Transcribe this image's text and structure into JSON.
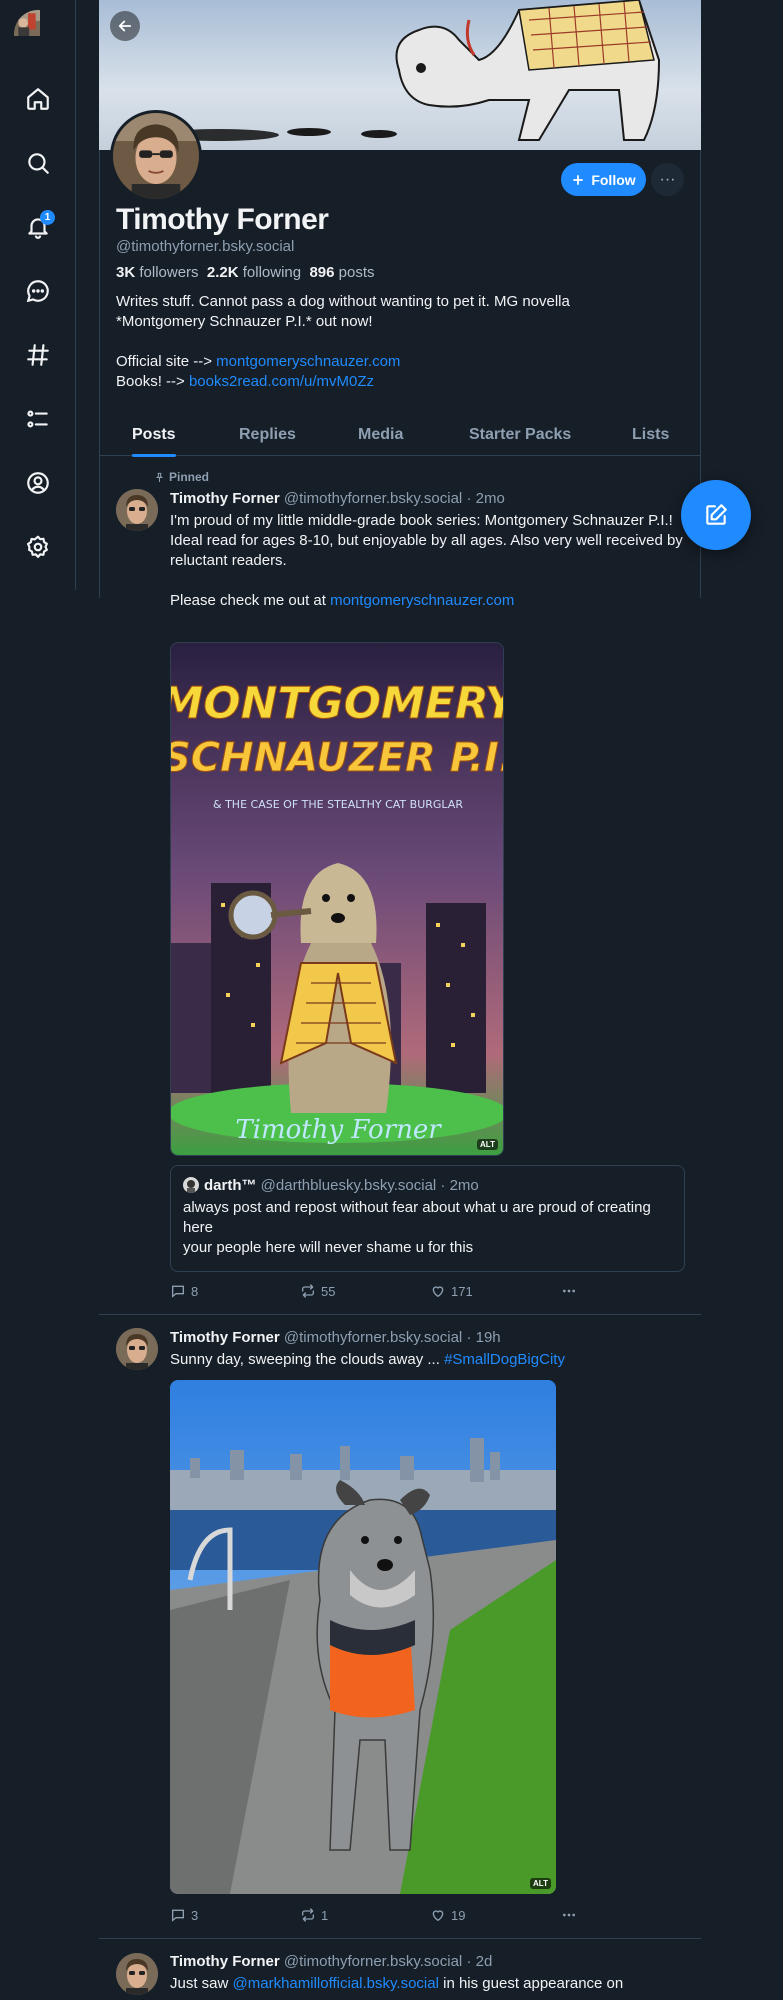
{
  "nav": {
    "notification_count": "1"
  },
  "profile": {
    "name": "Timothy Forner",
    "handle": "@timothyforner.bsky.social",
    "followers_count": "3K",
    "followers_label": "followers",
    "following_count": "2.2K",
    "following_label": "following",
    "posts_count": "896",
    "posts_label": "posts",
    "bio_line1": "Writes stuff. Cannot pass a dog without wanting to pet it. MG novella",
    "bio_line2": "*Montgomery Schnauzer P.I.* out now!",
    "site_prefix": "Official site --> ",
    "site_link": "montgomeryschnauzer.com",
    "books_prefix": "Books! --> ",
    "books_link": "books2read.com/u/mvM0Zz",
    "follow_label": "Follow",
    "more_label": "···"
  },
  "tabs": [
    "Posts",
    "Replies",
    "Media",
    "Starter Packs",
    "Lists"
  ],
  "posts": [
    {
      "pinned_label": "Pinned",
      "author": "Timothy Forner",
      "handle": "@timothyforner.bsky.social",
      "time": "· 2mo",
      "text1": "I'm proud of my little middle-grade book series: Montgomery Schnauzer P.I.!",
      "text2": "Ideal read for ages 8-10, but enjoyable by all ages. Also very well received by reluctant readers.",
      "text3_prefix": "Please check me out at ",
      "text3_link": "montgomeryschnauzer.com",
      "cover_title1": "MONTGOMERY",
      "cover_title2": "SCHNAUZER P.I.",
      "cover_subtitle": "& THE CASE OF THE STEALTHY CAT BURGLAR",
      "cover_author": "Timothy Forner",
      "alt": "ALT",
      "quote": {
        "author": "darth™",
        "handle": "@darthbluesky.bsky.social",
        "time": "· 2mo",
        "line1": "always post and repost without fear about what u are proud of creating here",
        "line2": "your people here will never shame u for this"
      },
      "replies": "8",
      "reposts": "55",
      "likes": "171"
    },
    {
      "author": "Timothy Forner",
      "handle": "@timothyforner.bsky.social",
      "time": "· 19h",
      "text_prefix": "Sunny day, sweeping the clouds away ... ",
      "hashtag": "#SmallDogBigCity",
      "alt": "ALT",
      "replies": "3",
      "reposts": "1",
      "likes": "19"
    },
    {
      "author": "Timothy Forner",
      "handle": "@timothyforner.bsky.social",
      "time": "· 2d",
      "text_prefix": "Just saw ",
      "mention": "@markhamillofficial.bsky.social",
      "text_suffix": " in his guest appearance on"
    }
  ],
  "colors": {
    "accent": "#208bfe",
    "background": "#161e27",
    "border": "#2e4052",
    "muted": "#8d9fb1"
  }
}
